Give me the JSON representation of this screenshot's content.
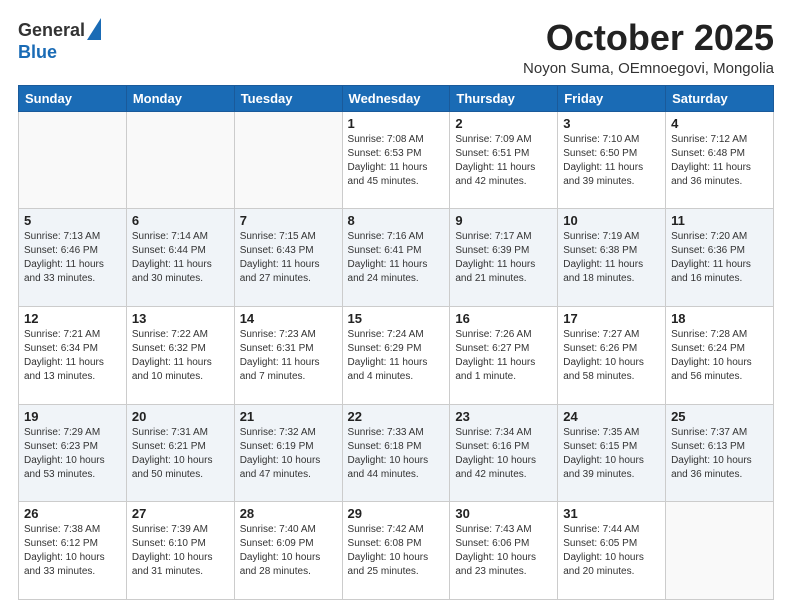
{
  "header": {
    "logo_general": "General",
    "logo_blue": "Blue",
    "month_title": "October 2025",
    "subtitle": "Noyon Suma, OEmnoegovi, Mongolia"
  },
  "weekdays": [
    "Sunday",
    "Monday",
    "Tuesday",
    "Wednesday",
    "Thursday",
    "Friday",
    "Saturday"
  ],
  "weeks": [
    [
      {
        "day": "",
        "info": ""
      },
      {
        "day": "",
        "info": ""
      },
      {
        "day": "",
        "info": ""
      },
      {
        "day": "1",
        "info": "Sunrise: 7:08 AM\nSunset: 6:53 PM\nDaylight: 11 hours\nand 45 minutes."
      },
      {
        "day": "2",
        "info": "Sunrise: 7:09 AM\nSunset: 6:51 PM\nDaylight: 11 hours\nand 42 minutes."
      },
      {
        "day": "3",
        "info": "Sunrise: 7:10 AM\nSunset: 6:50 PM\nDaylight: 11 hours\nand 39 minutes."
      },
      {
        "day": "4",
        "info": "Sunrise: 7:12 AM\nSunset: 6:48 PM\nDaylight: 11 hours\nand 36 minutes."
      }
    ],
    [
      {
        "day": "5",
        "info": "Sunrise: 7:13 AM\nSunset: 6:46 PM\nDaylight: 11 hours\nand 33 minutes."
      },
      {
        "day": "6",
        "info": "Sunrise: 7:14 AM\nSunset: 6:44 PM\nDaylight: 11 hours\nand 30 minutes."
      },
      {
        "day": "7",
        "info": "Sunrise: 7:15 AM\nSunset: 6:43 PM\nDaylight: 11 hours\nand 27 minutes."
      },
      {
        "day": "8",
        "info": "Sunrise: 7:16 AM\nSunset: 6:41 PM\nDaylight: 11 hours\nand 24 minutes."
      },
      {
        "day": "9",
        "info": "Sunrise: 7:17 AM\nSunset: 6:39 PM\nDaylight: 11 hours\nand 21 minutes."
      },
      {
        "day": "10",
        "info": "Sunrise: 7:19 AM\nSunset: 6:38 PM\nDaylight: 11 hours\nand 18 minutes."
      },
      {
        "day": "11",
        "info": "Sunrise: 7:20 AM\nSunset: 6:36 PM\nDaylight: 11 hours\nand 16 minutes."
      }
    ],
    [
      {
        "day": "12",
        "info": "Sunrise: 7:21 AM\nSunset: 6:34 PM\nDaylight: 11 hours\nand 13 minutes."
      },
      {
        "day": "13",
        "info": "Sunrise: 7:22 AM\nSunset: 6:32 PM\nDaylight: 11 hours\nand 10 minutes."
      },
      {
        "day": "14",
        "info": "Sunrise: 7:23 AM\nSunset: 6:31 PM\nDaylight: 11 hours\nand 7 minutes."
      },
      {
        "day": "15",
        "info": "Sunrise: 7:24 AM\nSunset: 6:29 PM\nDaylight: 11 hours\nand 4 minutes."
      },
      {
        "day": "16",
        "info": "Sunrise: 7:26 AM\nSunset: 6:27 PM\nDaylight: 11 hours\nand 1 minute."
      },
      {
        "day": "17",
        "info": "Sunrise: 7:27 AM\nSunset: 6:26 PM\nDaylight: 10 hours\nand 58 minutes."
      },
      {
        "day": "18",
        "info": "Sunrise: 7:28 AM\nSunset: 6:24 PM\nDaylight: 10 hours\nand 56 minutes."
      }
    ],
    [
      {
        "day": "19",
        "info": "Sunrise: 7:29 AM\nSunset: 6:23 PM\nDaylight: 10 hours\nand 53 minutes."
      },
      {
        "day": "20",
        "info": "Sunrise: 7:31 AM\nSunset: 6:21 PM\nDaylight: 10 hours\nand 50 minutes."
      },
      {
        "day": "21",
        "info": "Sunrise: 7:32 AM\nSunset: 6:19 PM\nDaylight: 10 hours\nand 47 minutes."
      },
      {
        "day": "22",
        "info": "Sunrise: 7:33 AM\nSunset: 6:18 PM\nDaylight: 10 hours\nand 44 minutes."
      },
      {
        "day": "23",
        "info": "Sunrise: 7:34 AM\nSunset: 6:16 PM\nDaylight: 10 hours\nand 42 minutes."
      },
      {
        "day": "24",
        "info": "Sunrise: 7:35 AM\nSunset: 6:15 PM\nDaylight: 10 hours\nand 39 minutes."
      },
      {
        "day": "25",
        "info": "Sunrise: 7:37 AM\nSunset: 6:13 PM\nDaylight: 10 hours\nand 36 minutes."
      }
    ],
    [
      {
        "day": "26",
        "info": "Sunrise: 7:38 AM\nSunset: 6:12 PM\nDaylight: 10 hours\nand 33 minutes."
      },
      {
        "day": "27",
        "info": "Sunrise: 7:39 AM\nSunset: 6:10 PM\nDaylight: 10 hours\nand 31 minutes."
      },
      {
        "day": "28",
        "info": "Sunrise: 7:40 AM\nSunset: 6:09 PM\nDaylight: 10 hours\nand 28 minutes."
      },
      {
        "day": "29",
        "info": "Sunrise: 7:42 AM\nSunset: 6:08 PM\nDaylight: 10 hours\nand 25 minutes."
      },
      {
        "day": "30",
        "info": "Sunrise: 7:43 AM\nSunset: 6:06 PM\nDaylight: 10 hours\nand 23 minutes."
      },
      {
        "day": "31",
        "info": "Sunrise: 7:44 AM\nSunset: 6:05 PM\nDaylight: 10 hours\nand 20 minutes."
      },
      {
        "day": "",
        "info": ""
      }
    ]
  ],
  "shaded_rows": [
    1,
    3
  ]
}
